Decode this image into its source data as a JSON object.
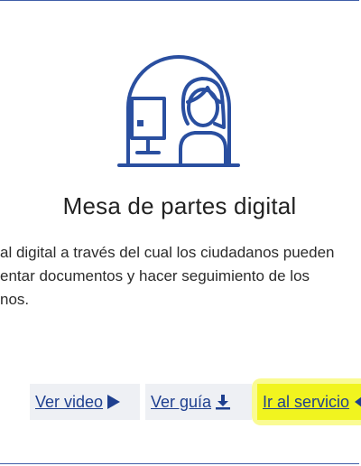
{
  "card": {
    "title": "Mesa de partes digital",
    "description_lines": [
      "al digital a través del cual los ciudadanos pueden",
      "entar documentos y hacer seguimiento de los",
      "nos."
    ]
  },
  "actions": {
    "video_label": "Ver video",
    "guide_label": "Ver guía",
    "service_label": "Ir al servicio"
  },
  "colors": {
    "accent": "#1e3f8f",
    "icon_stroke": "#2a4fa0",
    "highlight": "#f1f41f"
  },
  "icons": {
    "illustration": "person-at-desk-window-icon",
    "video": "play-icon",
    "guide": "download-icon",
    "service": "arrow-right-icon"
  }
}
